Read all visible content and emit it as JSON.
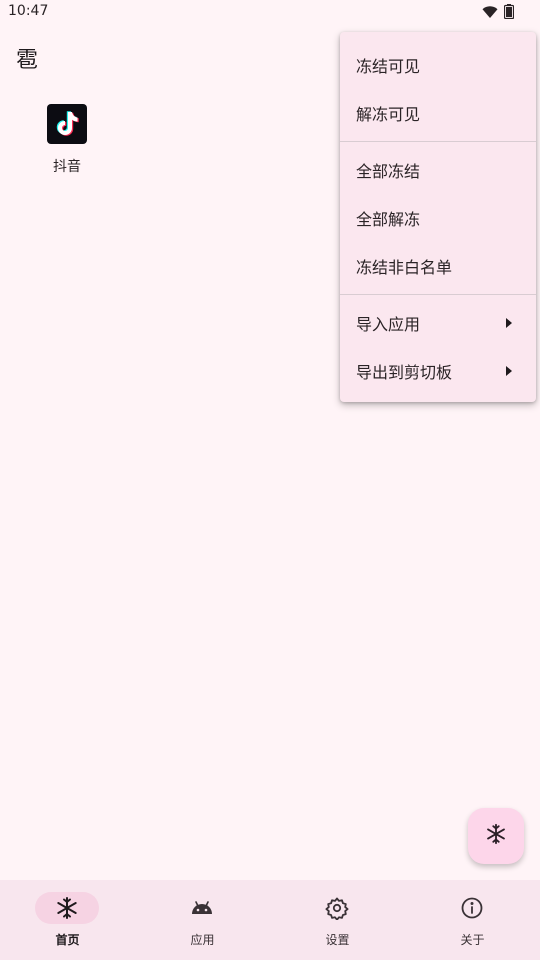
{
  "status_bar": {
    "time": "10:47",
    "icons": [
      "wifi-icon",
      "battery-icon"
    ]
  },
  "app_bar": {
    "title": "雹"
  },
  "apps": [
    {
      "label": "抖音",
      "icon": "tiktok-icon"
    }
  ],
  "menu": {
    "items": [
      {
        "label": "冻结可见",
        "has_submenu": false
      },
      {
        "label": "解冻可见",
        "has_submenu": false
      },
      {
        "label": "全部冻结",
        "has_submenu": false
      },
      {
        "label": "全部解冻",
        "has_submenu": false
      },
      {
        "label": "冻结非白名单",
        "has_submenu": false
      },
      {
        "label": "导入应用",
        "has_submenu": true
      },
      {
        "label": "导出到剪切板",
        "has_submenu": true
      }
    ]
  },
  "fab": {
    "icon": "snowflake-icon"
  },
  "bottom_nav": {
    "selected": "首页",
    "items": [
      {
        "label": "首页",
        "icon": "snowflake-icon"
      },
      {
        "label": "应用",
        "icon": "android-icon"
      },
      {
        "label": "设置",
        "icon": "gear-icon"
      },
      {
        "label": "关于",
        "icon": "info-icon"
      }
    ]
  },
  "colors": {
    "background": "#fff4f7",
    "menu_background": "#fbe7ef",
    "nav_background": "#f8e6ee",
    "nav_active_pill": "#f6d3e3",
    "fab_background": "#fdd6ea"
  }
}
